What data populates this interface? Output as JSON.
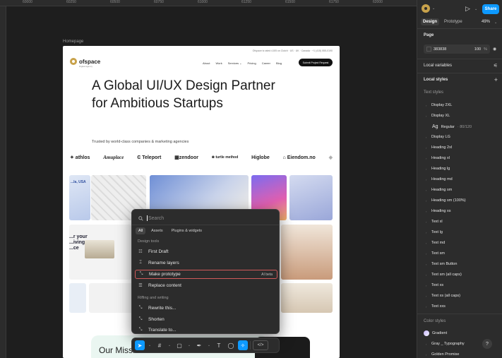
{
  "canvas": {
    "ruler_labels": [
      "60000",
      "60250",
      "60500",
      "60750",
      "61000",
      "61250",
      "61500",
      "61750",
      "62000"
    ],
    "frame_label": "Homepage"
  },
  "website": {
    "topline": "Ofspace is rated 4.8/5 on Clutch · US · UK · Canada · +1 (415) 555-0190",
    "logo_name": "ofspace",
    "logo_tagline": "Digital Agency",
    "nav": [
      "About",
      "Work",
      "Services ⌄",
      "Pricing",
      "Career",
      "Blog"
    ],
    "cta": "Submit Project Request",
    "hero_line1": "A Global UI/UX Design Partner",
    "hero_line2": "for Ambitious Startups",
    "trusted": "Trusted by world-class companies & marketing agencies",
    "client_logos": [
      "✦ athlos",
      "Amuplace",
      "Ͼ Teleport",
      "▦zendoor",
      "❀ turtle method",
      "Higlobe",
      "⌂ Eiendom.no",
      "◈"
    ],
    "tile_text_1": "...la, USA",
    "tile_text_2": "...r your\n...iving\n...ce",
    "bottom_heading": "Our Mission"
  },
  "quick_actions": {
    "search_placeholder": "Search",
    "tabs": [
      "All",
      "Assets",
      "Plugins & widgets"
    ],
    "sections": {
      "design_tools": "Design tools",
      "riffing": "Riffing and writing"
    },
    "items": [
      {
        "label": "First Draft",
        "icon": "first-draft"
      },
      {
        "label": "Rename layers",
        "icon": "rename-layers"
      },
      {
        "label": "Make prototype",
        "icon": "make-prototype",
        "badge": "AI beta"
      },
      {
        "label": "Replace content",
        "icon": "replace-content"
      },
      {
        "label": "Rewrite this...",
        "icon": "rewrite"
      },
      {
        "label": "Shorten",
        "icon": "shorten"
      },
      {
        "label": "Translate to...",
        "icon": "translate"
      }
    ]
  },
  "toolbar": {
    "tools": [
      "move",
      "frame",
      "rectangle",
      "pen",
      "text",
      "comment",
      "actions",
      "dev-mode"
    ],
    "dev_label": "</>"
  },
  "panel": {
    "share_label": "Share",
    "tabs": [
      "Design",
      "Prototype"
    ],
    "zoom": "49%",
    "page_heading": "Page",
    "page_color_hex": "383838",
    "page_color_opacity": "100",
    "page_color_pct": "%",
    "local_variables": "Local variables",
    "local_styles": "Local styles",
    "text_styles_heading": "Text styles",
    "text_styles": [
      "Display 2XL",
      "Display XL",
      "Display LG",
      "Heading 2xl",
      "Heading xl",
      "Heading lg",
      "Heading md",
      "Heading sm",
      "Heading sm (100%)",
      "Heading xs",
      "Text xl",
      "Text lg",
      "Text md",
      "Text sm",
      "Text sm Button",
      "Text sm (all caps)",
      "Text xs",
      "Text xs (all caps)",
      "Text xxs"
    ],
    "sub_style": {
      "prefix": "Ag",
      "name": "Regular",
      "meta": "· 80/120"
    },
    "color_styles_heading": "Color styles",
    "color_styles": [
      "Gradient",
      "Gray _ Typography",
      "Golden Promise"
    ],
    "help": "?"
  }
}
